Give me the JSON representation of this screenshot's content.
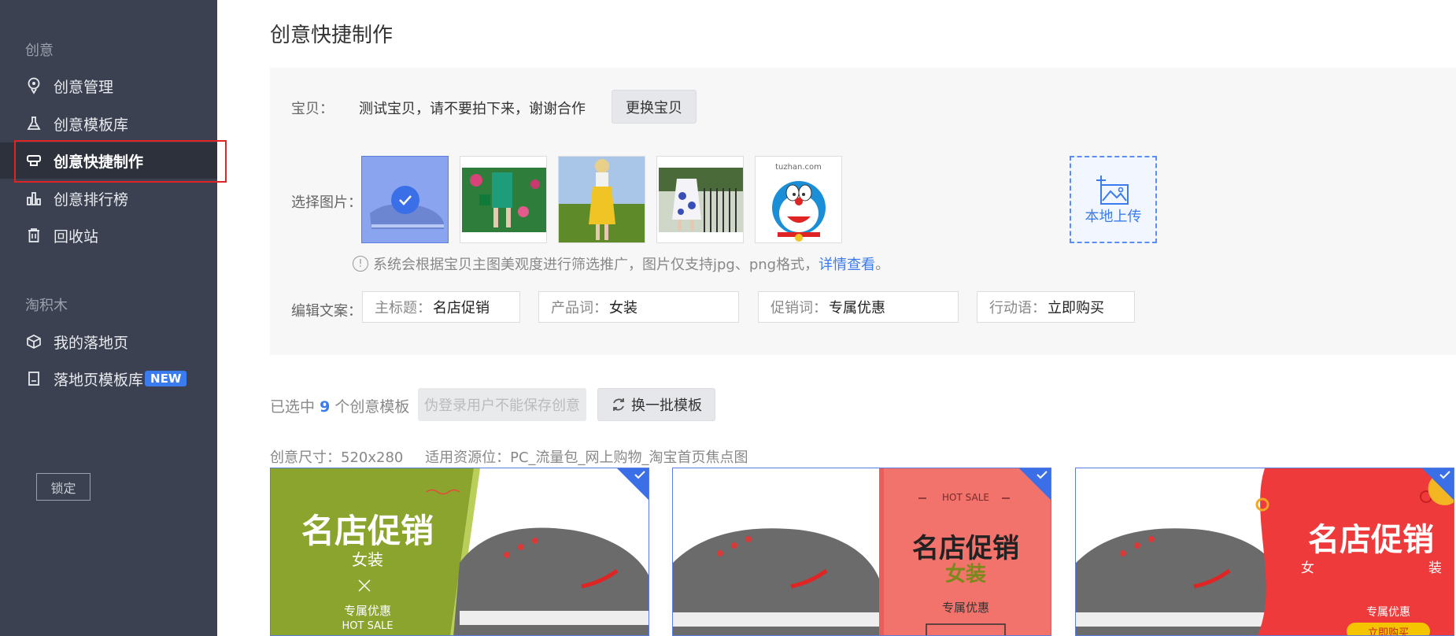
{
  "sidebar": {
    "section1": "创意",
    "items": [
      {
        "label": "创意管理"
      },
      {
        "label": "创意模板库"
      },
      {
        "label": "创意快捷制作"
      },
      {
        "label": "创意排行榜"
      },
      {
        "label": "回收站"
      }
    ],
    "section2": "淘积木",
    "items2": [
      {
        "label": "我的落地页"
      },
      {
        "label": "落地页模板库",
        "badge": "NEW"
      }
    ],
    "lock_label": "锁定"
  },
  "main": {
    "title": "创意快捷制作",
    "item_label": "宝贝：",
    "item_name": "测试宝贝，请不要拍下来，谢谢合作",
    "change_item": "更换宝贝",
    "select_image_label": "选择图片：",
    "thumb5_text": "tuzhan.com",
    "upload_label": "本地上传",
    "hint_text": "系统会根据宝贝主图美观度进行筛选推广，图片仅支持jpg、png格式，",
    "hint_link": "详情查看",
    "hint_end": "。",
    "copy_label": "编辑文案：",
    "fields": [
      {
        "label": "主标题：",
        "value": "名店促销"
      },
      {
        "label": "产品词：",
        "value": "女装"
      },
      {
        "label": "促销词：",
        "value": "专属优惠"
      },
      {
        "label": "行动语：",
        "value": "立即购买"
      }
    ],
    "selected_prefix": "已选中",
    "selected_count": "9",
    "selected_suffix": "个创意模板",
    "save_disabled": "伪登录用户不能保存创意",
    "swap_templates": "换一批模板",
    "size_info": "创意尺寸：520x280",
    "slot_info": "适用资源位：PC_流量包_网上购物_淘宝首页焦点图"
  },
  "cards": [
    {
      "title": "名店促销",
      "sub": "女装",
      "promo": "专属优惠",
      "tag": "HOT SALE",
      "bg": "#8aa42e"
    },
    {
      "tag": "HOT SALE",
      "title": "名店促销",
      "sub": "女装",
      "promo": "专属优惠",
      "bg": "#f2726c"
    },
    {
      "title": "名店促销",
      "sub_l": "女",
      "sub_r": "装",
      "promo": "专属优惠",
      "cta": "立即购买",
      "bg": "#ee3a3a"
    }
  ],
  "colors": {
    "accent": "#3a7bf0",
    "sidebar": "#3b4150",
    "highlight": "#e02424"
  }
}
